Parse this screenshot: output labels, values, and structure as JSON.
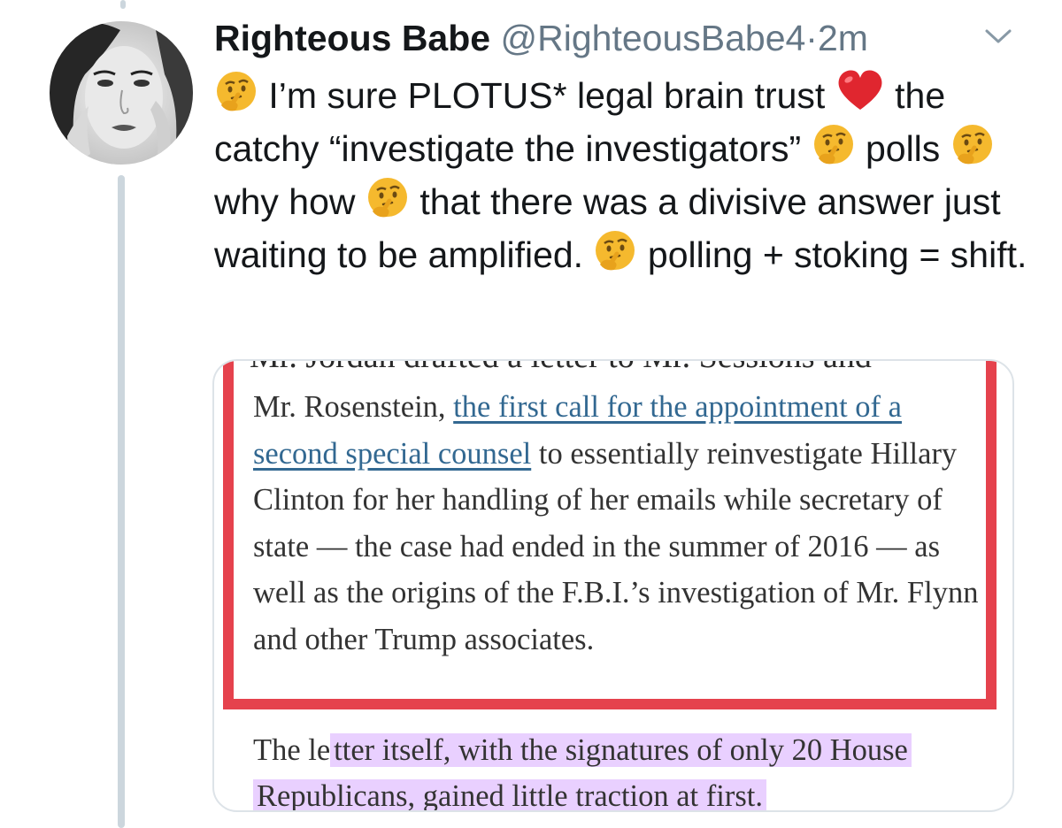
{
  "tweet": {
    "author_name": "Righteous Babe",
    "handle": "@RighteousBabe4",
    "separator": "·",
    "time": "2m",
    "menu_icon": "chevron-down-icon",
    "avatar_icon": "profile-photo",
    "text": {
      "seg1": "I’m sure PLOTUS* legal brain trust",
      "seg2": "the catchy “investigate the investigators”",
      "seg3": "polls",
      "seg4": "why how",
      "seg5": "that there was a divisive answer just waiting to be amplified.",
      "seg6": "polling + stoking = shift."
    },
    "emoji": {
      "thinking": "thinking-face-emoji",
      "heart": "red-heart-emoji"
    }
  },
  "article_image": {
    "clipped_top_line": "Mr. Jordan drafted a letter to Mr. Sessions and",
    "para1_start": "Mr. Rosenstein,",
    "para1_link": "the first call for the appointment of a second special counsel",
    "para1_rest": "to essentially reinvestigate Hillary Clinton for her handling of her emails while secretary of state — the case had ended in the summer of 2016 — as well as the origins of the F.B.I.’s investigation of Mr. Flynn and other Trump associates.",
    "para2_start": "The le",
    "para2_highlight": "tter itself, with the signatures of only 20 House Republicans, gained little traction at first.",
    "colors": {
      "box_border": "#e5424d",
      "link": "#326891",
      "highlighter": "#ce96ff"
    }
  }
}
